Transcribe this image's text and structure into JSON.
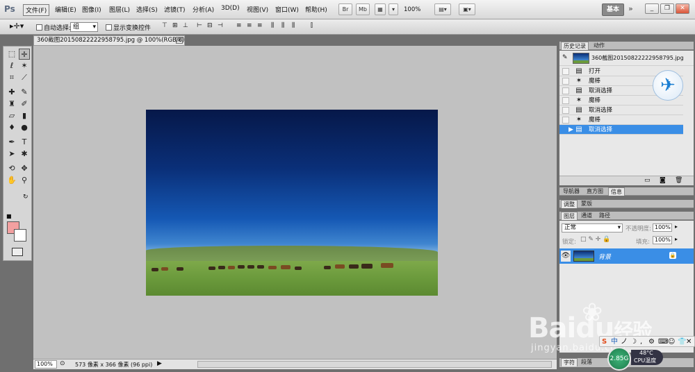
{
  "app": {
    "logo": "Ps"
  },
  "menu": [
    "文件(F)",
    "编辑(E)",
    "图像(I)",
    "图层(L)",
    "选择(S)",
    "滤镜(T)",
    "分析(A)",
    "3D(D)",
    "视图(V)",
    "窗口(W)",
    "帮助(H)"
  ],
  "menubar": {
    "bridge": "Br",
    "minibridge": "Mb",
    "zoom": "100%",
    "workspace": "基本",
    "window_controls": {
      "collapse": "»",
      "minimize": "_",
      "restore": "❐",
      "close": "✕"
    }
  },
  "options": {
    "auto_select_label": "自动选择:",
    "auto_select_value": "组",
    "show_transform_label": "显示变换控件"
  },
  "document": {
    "tab_title": "360截图20150822222958795.jpg @ 100%(RGB/8)",
    "tab_close": "✕"
  },
  "status": {
    "zoom": "100%",
    "info": "573 像素 x 366 像素 (96 ppi)"
  },
  "panels": {
    "history_tabs": [
      "历史记录",
      "动作"
    ],
    "snapshot_label": "360截图20150822222958795.jpg",
    "history_items": [
      {
        "icon": "open",
        "label": "打开",
        "selected": false
      },
      {
        "icon": "wand",
        "label": "魔棒",
        "selected": false
      },
      {
        "icon": "deselect",
        "label": "取消选择",
        "selected": false
      },
      {
        "icon": "wand",
        "label": "魔棒",
        "selected": false
      },
      {
        "icon": "deselect",
        "label": "取消选择",
        "selected": false
      },
      {
        "icon": "wand",
        "label": "魔棒",
        "selected": false
      },
      {
        "icon": "deselect",
        "label": "取消选择",
        "selected": true
      }
    ],
    "nav_tabs": [
      "导航器",
      "直方图",
      "信息"
    ],
    "adjust_tabs": [
      "调整",
      "蒙版"
    ],
    "layers_tabs": [
      "图层",
      "通道",
      "路径"
    ],
    "blend_mode": "正常",
    "opacity_label": "不透明度:",
    "opacity_value": "100%",
    "lock_label": "锁定:",
    "fill_label": "填充:",
    "fill_value": "100%",
    "layer_name": "背景",
    "bottom_tabs": [
      "字符",
      "段落"
    ]
  },
  "watermark": {
    "brand": "Bai",
    "brand_end": "经验",
    "sub": "jingyan.baidu.com"
  },
  "tray": {
    "ime_mode": "中",
    "memory": "2.85G",
    "cpu_temp": "48°C",
    "cpu_label": "CPU温度"
  }
}
